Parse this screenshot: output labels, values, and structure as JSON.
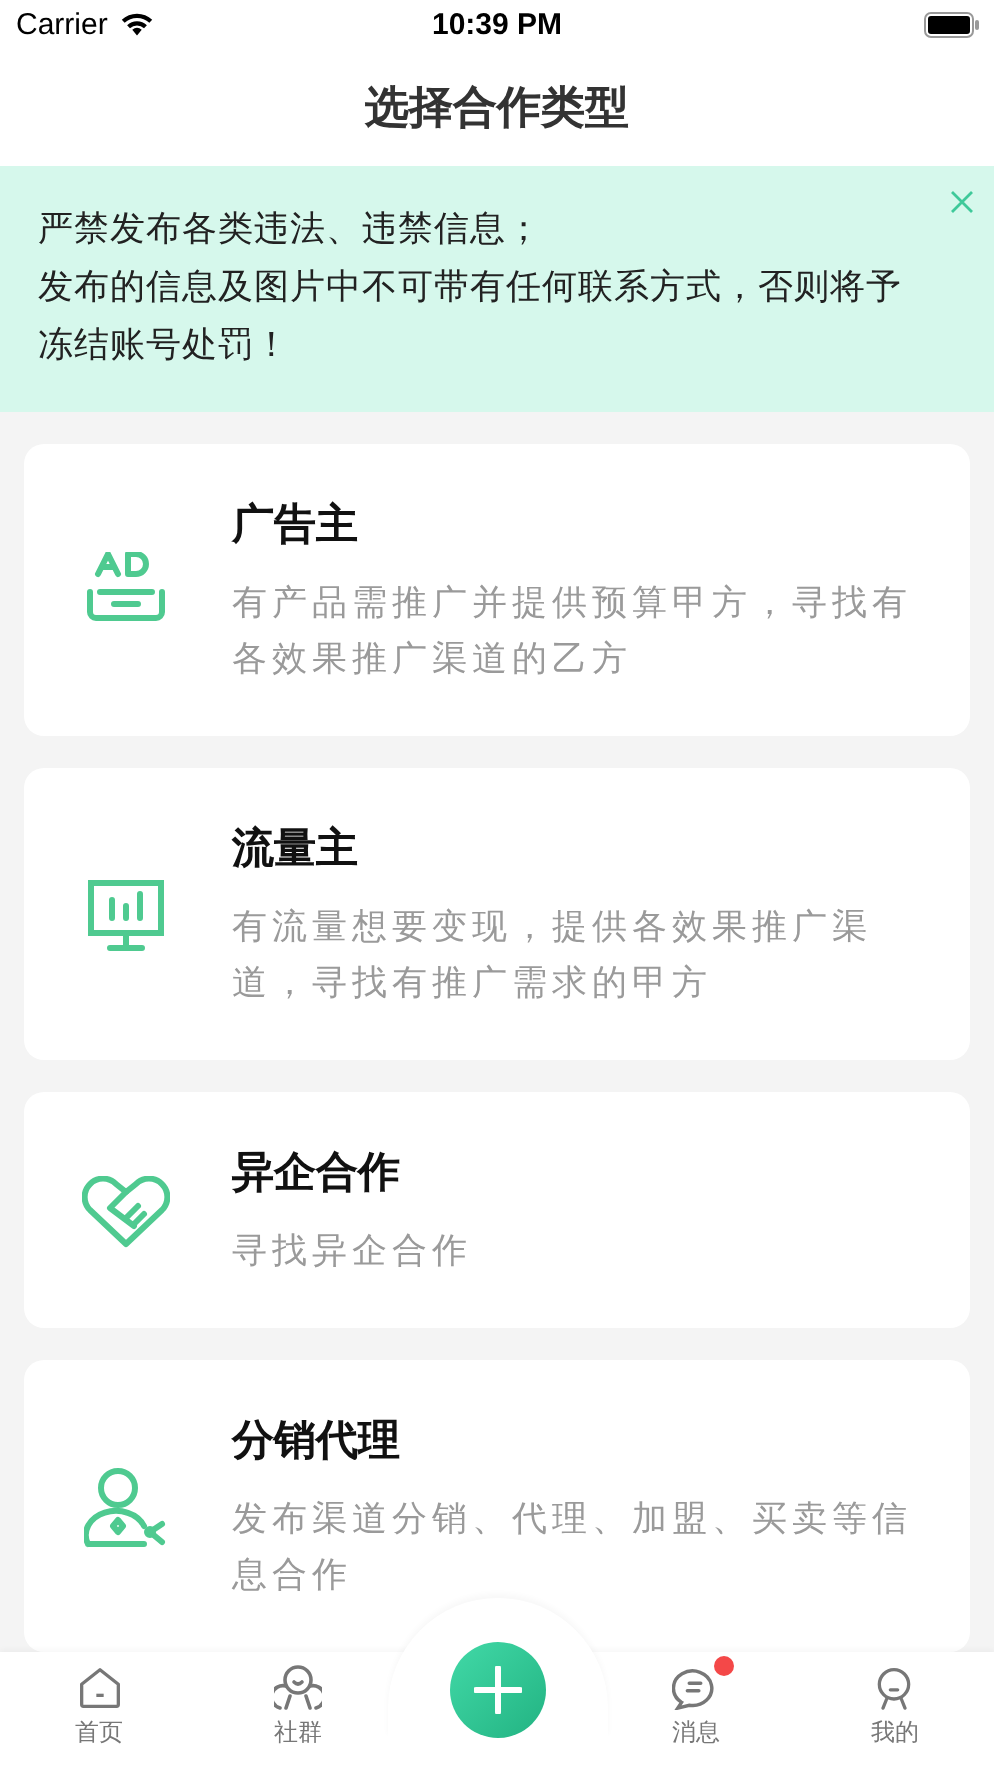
{
  "status_bar": {
    "carrier": "Carrier",
    "time": "10:39 PM"
  },
  "nav": {
    "title": "选择合作类型"
  },
  "notice": {
    "lines": [
      "严禁发布各类违法、违禁信息；",
      "发布的信息及图片中不可带有任何联系方式，否则将予冻结账号处罚！"
    ]
  },
  "cards": [
    {
      "kind": "ad",
      "title": "广告主",
      "desc": "有产品需推广并提供预算甲方，寻找有各效果推广渠道的乙方"
    },
    {
      "kind": "monitor",
      "title": "流量主",
      "desc": "有流量想要变现，提供各效果推广渠道，寻找有推广需求的甲方"
    },
    {
      "kind": "heart",
      "title": "异企合作",
      "desc": "寻找异企合作"
    },
    {
      "kind": "person",
      "title": "分销代理",
      "desc": "发布渠道分销、代理、加盟、买卖等信息合作"
    }
  ],
  "tab_bar": [
    {
      "kind": "home",
      "label": "首页",
      "selected": false,
      "badge": false
    },
    {
      "kind": "group",
      "label": "社群",
      "selected": false,
      "badge": false
    },
    {
      "kind": "add"
    },
    {
      "kind": "message",
      "label": "消息",
      "selected": false,
      "badge": true
    },
    {
      "kind": "profile",
      "label": "我的",
      "selected": false,
      "badge": false
    }
  ]
}
